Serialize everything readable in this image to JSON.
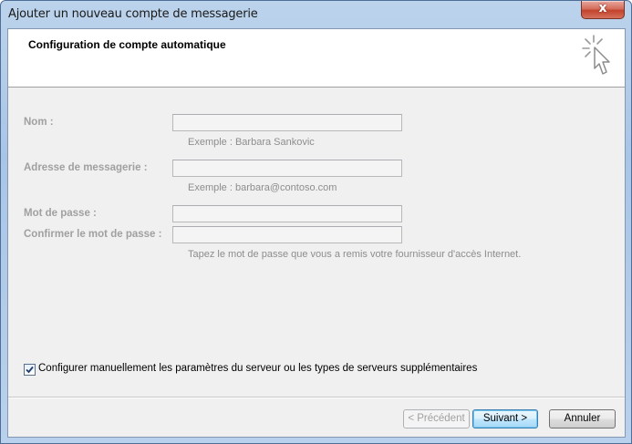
{
  "window": {
    "title": "Ajouter un nouveau compte de messagerie",
    "close_symbol": "x"
  },
  "header": {
    "title": "Configuration de compte automatique",
    "icon": "cursor-sparkle-icon"
  },
  "form": {
    "name_label": "Nom :",
    "name_value": "",
    "name_hint": "Exemple : Barbara Sankovic",
    "email_label": "Adresse de messagerie :",
    "email_value": "",
    "email_hint": "Exemple : barbara@contoso.com",
    "password_label": "Mot de passe :",
    "password_value": "",
    "confirm_label": "Confirmer le mot de passe :",
    "confirm_value": "",
    "password_hint": "Tapez le mot de passe que vous a remis votre fournisseur d'accès Internet."
  },
  "manual_config": {
    "checked": true,
    "label": "Configurer manuellement les paramètres du serveur ou les types de serveurs supplémentaires"
  },
  "buttons": {
    "previous": "< Précédent",
    "next": "Suivant >",
    "cancel": "Annuler"
  }
}
